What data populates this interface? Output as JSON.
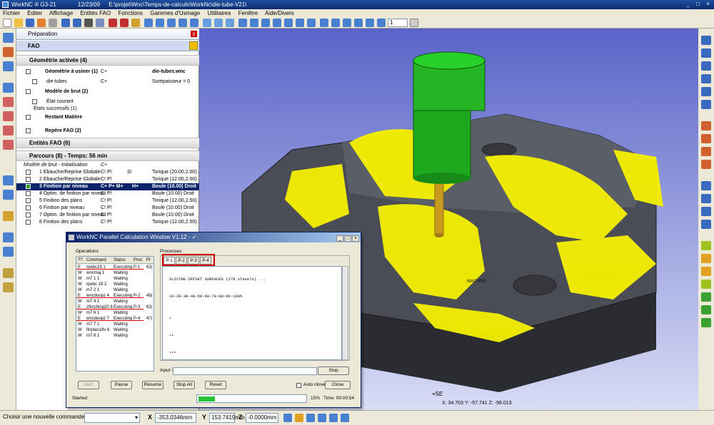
{
  "titlebar": {
    "app": "WorkNC ® G3-21",
    "date": "12/23/09",
    "path": "E:\\projet\\Wnc\\Temps-de-calculs\\WorkNc\\die-tube-V21\\"
  },
  "menu": [
    "Fichier",
    "Editer",
    "Affichage",
    "Entités FAO",
    "Fonctions",
    "Gammes d'Usinage",
    "Utilitaires",
    "Fenêtre",
    "Aide/Divers"
  ],
  "toolbar": {
    "zoom_value": "1"
  },
  "panel": {
    "header": "Préparation",
    "close": "x",
    "fao_label": "FAO",
    "geom_title": "Géométrie activée (4)",
    "geom_rows": [
      {
        "label": "Géométrie à usiner (1)",
        "col2": "C+",
        "col3": "die-tubes.wnc",
        "bold": true
      },
      {
        "label": "die-tubes",
        "col2": "C+",
        "col3": "Surépaisseur = 0",
        "bold": false
      },
      {
        "label": "Modèle de brut (2)",
        "col2": "",
        "col3": "",
        "bold": true
      },
      {
        "label": "État courant",
        "col2": "",
        "col3": "",
        "bold": false
      },
      {
        "label": "États successifs (1)",
        "col2": "",
        "col3": "",
        "bold": false
      },
      {
        "label": "Restant Matière",
        "col2": "",
        "col3": "",
        "bold": true
      },
      {
        "label": "Repère FAO (2)",
        "col2": "",
        "col3": "",
        "bold": true
      }
    ],
    "entities_title": "Entités FAO (6)",
    "parcours_title": "Parcours (8) - Temps: 56 min",
    "parcours_rows": [
      {
        "label": "Modèle de brut - Initialisation",
        "c1": "C+",
        "c2": "",
        "c3": ""
      },
      {
        "label": "1 Ebauche/Reprise Globale",
        "c1": "C! P!",
        "c2": "S!",
        "c3": "Torique (20.00,2.00) ..."
      },
      {
        "label": "2 Ebauche/Reprise Globale",
        "c1": "C! P!",
        "c2": "",
        "c3": "Torique (12.00,2.00) ..."
      },
      {
        "label": "3 Finition par niveau",
        "c1": "C+ P+ M+",
        "c2": "H+",
        "c3": "Boule (10.00) Droit"
      },
      {
        "label": "4 Optim. de finition par niveau",
        "c1": "C! P!",
        "c2": "",
        "c3": "Boule (10.00) Droit"
      },
      {
        "label": "5 Finition des plans",
        "c1": "C! P!",
        "c2": "",
        "c3": "Torique (12.00,2.50) ..."
      },
      {
        "label": "6 Finition par niveau",
        "c1": "C! P!",
        "c2": "",
        "c3": "Boule (10.00) Droit"
      },
      {
        "label": "7 Optim. de finition par niveau",
        "c1": "C! P!",
        "c2": "",
        "c3": "Boule (10.00) Droit"
      },
      {
        "label": "8 Finition des plans",
        "c1": "C! P!",
        "c2": "",
        "c3": "Torique (12.00,2.50) ..."
      }
    ]
  },
  "viewport": {
    "machine_label": "MACHINE",
    "view_label": "SE",
    "coords": "X: 34.703   Y: -57.741   Z: -56.013"
  },
  "dialog": {
    "title": "WorkNC Parallel Calculation Window V1.12 - ✓",
    "operations_label": "Operations",
    "processes_label": "Processes",
    "op_headers": [
      "??",
      "Command",
      "Status",
      "Proc",
      "PI"
    ],
    "operations": [
      {
        "flag": "E",
        "cmd": "rpebc19 1",
        "status": "Executing",
        "proc": "P-1",
        "pi": "62("
      },
      {
        "flag": "W",
        "cmd": "wncmaj 1",
        "status": "Waiting",
        "proc": "",
        "pi": ""
      },
      {
        "flag": "W",
        "cmd": "m7 1 1",
        "status": "Waiting",
        "proc": "",
        "pi": ""
      },
      {
        "flag": "W",
        "cmd": "rpebc 19 2",
        "status": "Waiting",
        "proc": "",
        "pi": ""
      },
      {
        "flag": "W",
        "cmd": "m7 2 1",
        "status": "Waiting",
        "proc": "",
        "pi": ""
      },
      {
        "flag": "E",
        "cmd": "wncdoopz 4",
        "status": "Executing",
        "proc": "P-2",
        "pi": "48("
      },
      {
        "flag": "W",
        "cmd": "m7 4 1",
        "status": "Waiting",
        "proc": "",
        "pi": ""
      },
      {
        "flag": "E",
        "cmd": "zfinishing20 6",
        "status": "Executing",
        "proc": "P-3",
        "pi": "62("
      },
      {
        "flag": "W",
        "cmd": "m7 6 1",
        "status": "Waiting",
        "proc": "",
        "pi": ""
      },
      {
        "flag": "E",
        "cmd": "wncdoopz 7",
        "status": "Executing",
        "proc": "P-4",
        "pi": "47("
      },
      {
        "flag": "W",
        "cmd": "m7 7 1",
        "status": "Waiting",
        "proc": "",
        "pi": ""
      },
      {
        "flag": "W",
        "cmd": "finplan18v 8",
        "status": "Waiting",
        "proc": "",
        "pi": ""
      },
      {
        "flag": "W",
        "cmd": "m7 8 1",
        "status": "Waiting",
        "proc": "",
        "pi": ""
      }
    ],
    "tabs": [
      "P-1",
      "P-2",
      "P-3",
      "P-4"
    ],
    "console": [
      "SLICING OFFSET SURFACES (279 slevels) ...",
      "10-20-30-40-50-60-70-80-90-100%",
      "*",
      "**",
      "***"
    ],
    "input_label": "Input >",
    "stop_label": "Stop",
    "buttons": {
      "start": "Start",
      "pause": "Pause",
      "resume": "Resume",
      "stop_all": "Stop All",
      "reset": "Reset",
      "close": "Close"
    },
    "autoclose_label": "Auto close",
    "status_text": "Started",
    "progress_percent": 15,
    "progress_label": "15%",
    "time_label": "Time: 00:00:54"
  },
  "statusbar": {
    "message": "Choisir une nouvelle commande ...",
    "x_label": "X",
    "x_value": "-353.0346mm",
    "y_label": "Y",
    "y_value": "153.7419mm",
    "z_label": "Z",
    "z_value": "-0.0000mm"
  },
  "colors": {
    "toolpath": "#f5f000",
    "tool_body": "#1ea81e",
    "tool_shank": "#c89a20",
    "part": "#4a4d55",
    "selection": "#0a246a",
    "highlight": "#d40000",
    "progress": "#26c23a"
  }
}
